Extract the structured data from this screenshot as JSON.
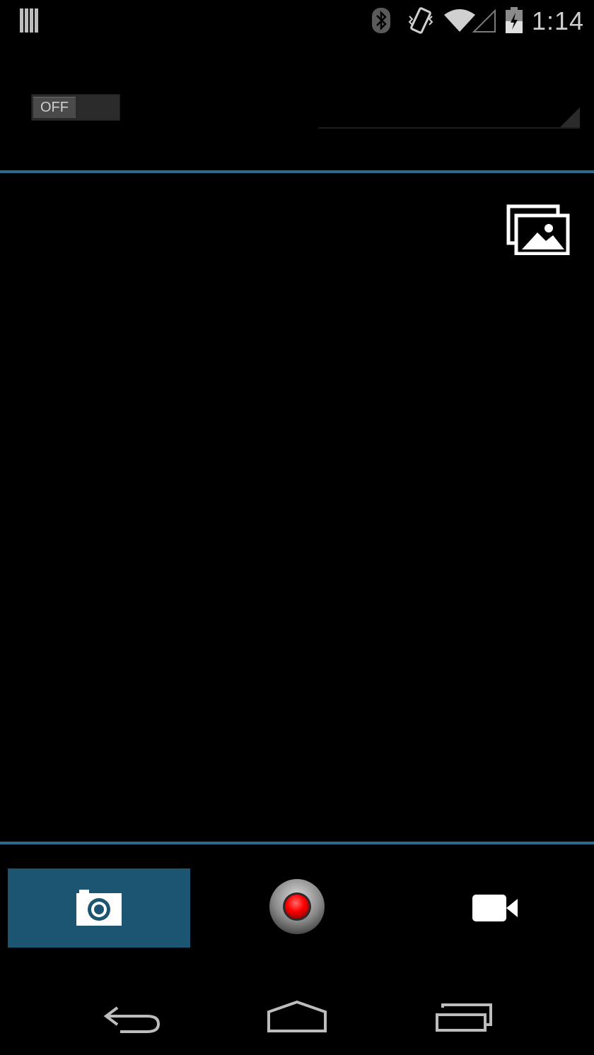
{
  "status_bar": {
    "time": "1:14",
    "icons": [
      "notification-bars-icon",
      "bluetooth-icon",
      "vibrate-icon",
      "wifi-icon",
      "signal-icon",
      "battery-charging-icon"
    ]
  },
  "controls": {
    "toggle_label": "OFF",
    "toggle_state": "off"
  },
  "toolbar": {
    "gallery_icon": "gallery-icon"
  },
  "modes": {
    "selected": "photo",
    "items": [
      "photo-mode",
      "record-button",
      "video-mode"
    ]
  },
  "colors": {
    "accent": "#2a6a8c",
    "selected_mode_bg": "#1b5572",
    "record": "#ff0000"
  },
  "navigation": {
    "items": [
      "back-icon",
      "home-icon",
      "recent-apps-icon"
    ]
  }
}
